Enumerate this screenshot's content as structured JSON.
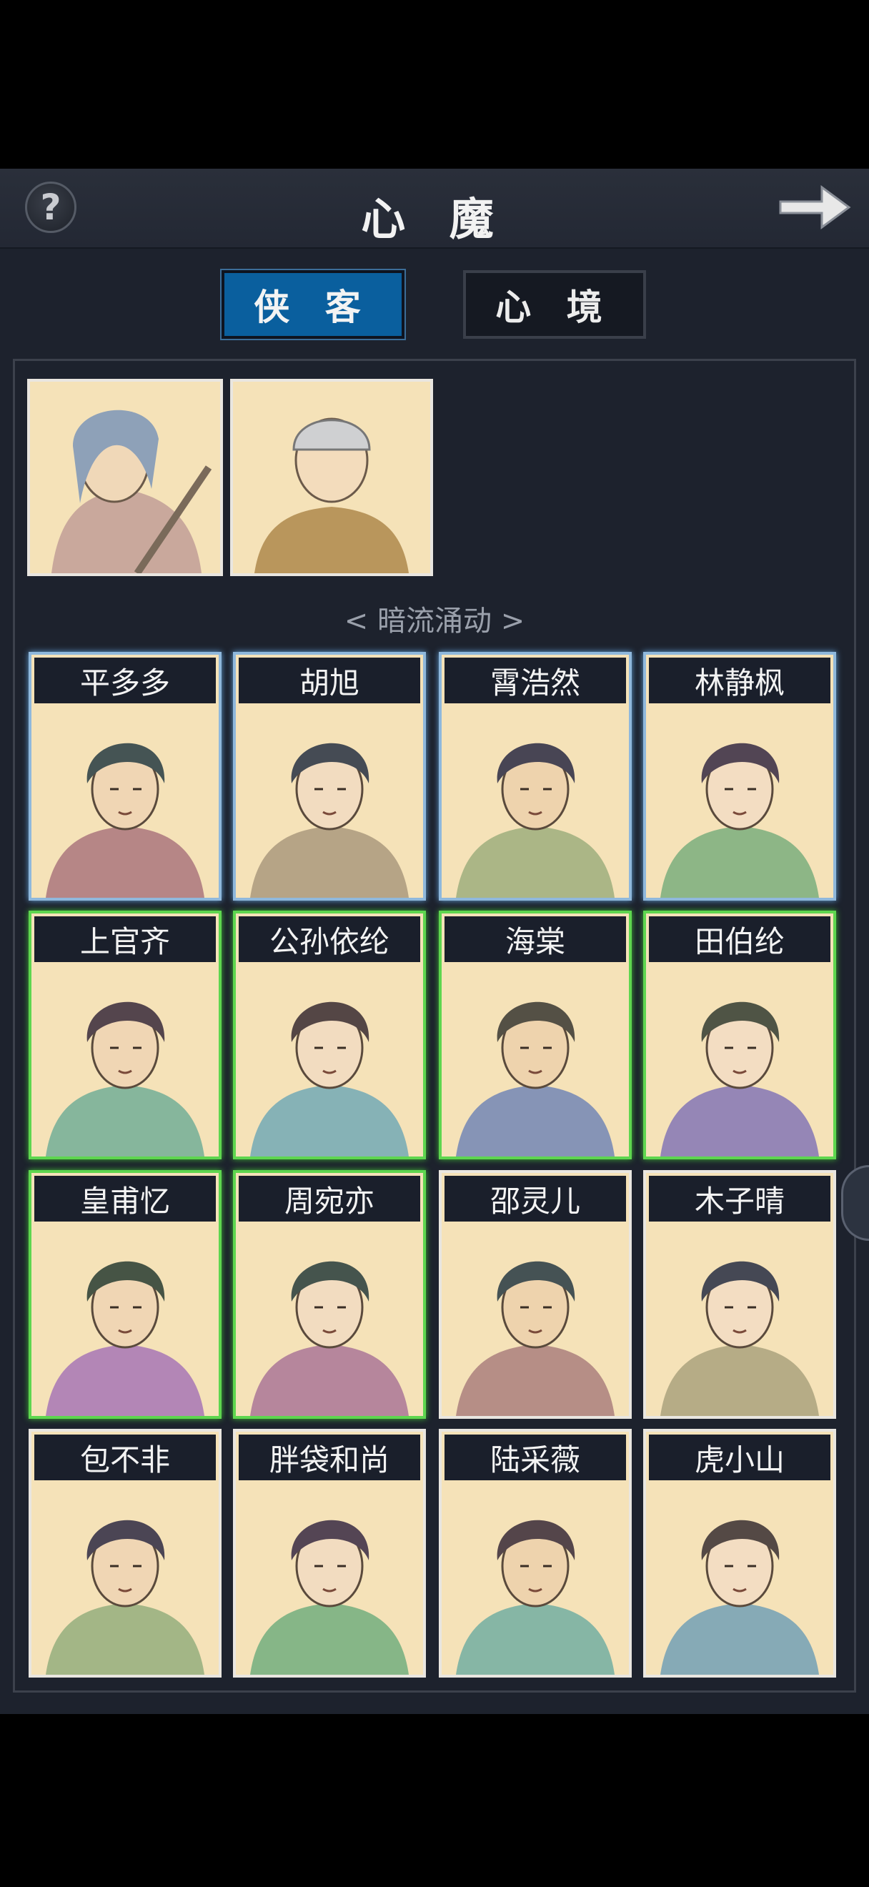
{
  "header": {
    "title": "心 魔",
    "help_label": "?"
  },
  "tabs": [
    {
      "label": "侠 客",
      "active": true
    },
    {
      "label": "心 境",
      "active": false
    }
  ],
  "section_label": "< 暗流涌动 >",
  "portraits_top": [
    {
      "icon": "elder-swordsman-portrait"
    },
    {
      "icon": "monk-portrait"
    }
  ],
  "characters": [
    {
      "name": "平多多",
      "tier": "blue"
    },
    {
      "name": "胡旭",
      "tier": "blue"
    },
    {
      "name": "霄浩然",
      "tier": "blue"
    },
    {
      "name": "林静枫",
      "tier": "blue"
    },
    {
      "name": "上官齐",
      "tier": "green"
    },
    {
      "name": "公孙依纶",
      "tier": "green"
    },
    {
      "name": "海棠",
      "tier": "green"
    },
    {
      "name": "田伯纶",
      "tier": "green"
    },
    {
      "name": "皇甫忆",
      "tier": "green"
    },
    {
      "name": "周宛亦",
      "tier": "green"
    },
    {
      "name": "邵灵儿",
      "tier": "white"
    },
    {
      "name": "木子晴",
      "tier": "white"
    },
    {
      "name": "包不非",
      "tier": "white"
    },
    {
      "name": "胖袋和尚",
      "tier": "white"
    },
    {
      "name": "陆采薇",
      "tier": "white"
    },
    {
      "name": "虎小山",
      "tier": "white"
    }
  ],
  "colors": {
    "tab_active": "#0a5f9e",
    "tier_blue": "#8fb8dc",
    "tier_green": "#5ed64f",
    "card_bg": "#f5e2b8"
  }
}
